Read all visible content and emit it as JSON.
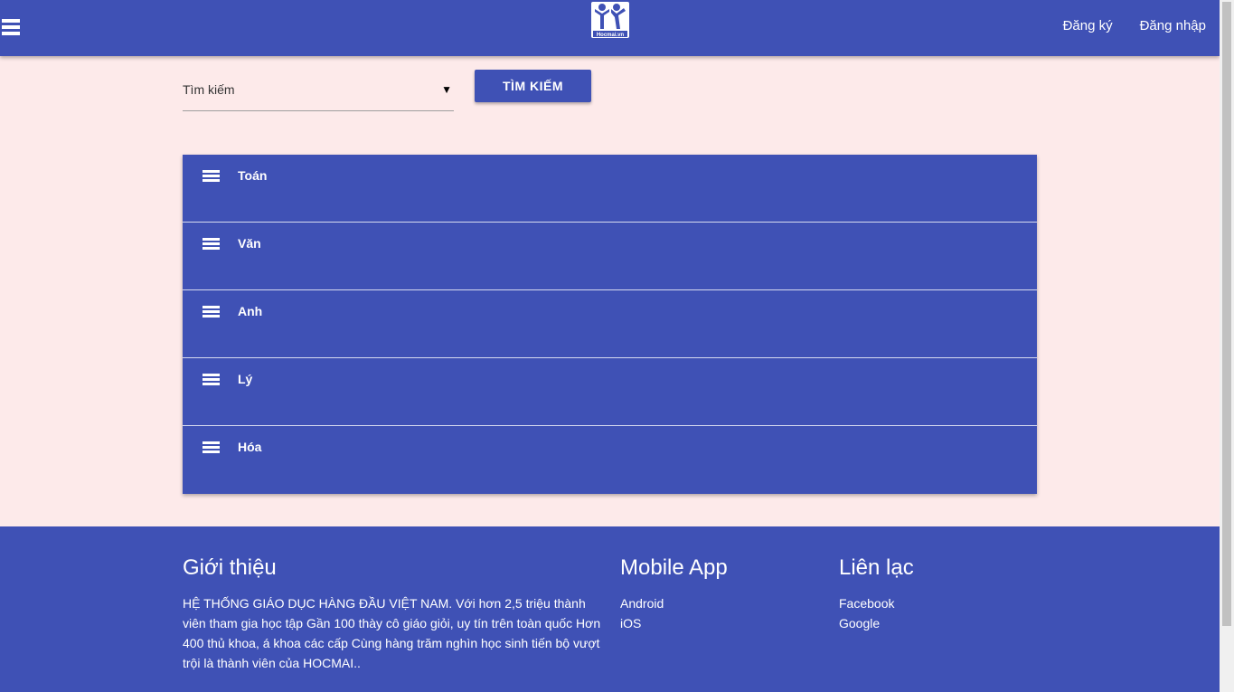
{
  "header": {
    "register_label": "Đăng ký",
    "login_label": "Đăng nhập",
    "logo_text": "Hocmai.vn"
  },
  "search": {
    "select_value": "Tìm kiếm",
    "button_label": "TÌM KIẾM"
  },
  "subjects": [
    {
      "label": "Toán"
    },
    {
      "label": "Văn"
    },
    {
      "label": "Anh"
    },
    {
      "label": "Lý"
    },
    {
      "label": "Hóa"
    }
  ],
  "footer": {
    "intro_title": "Giới thiệu",
    "intro_text": "HỆ THỐNG GIÁO DỤC HÀNG ĐẦU VIỆT NAM. Với hơn 2,5 triệu thành viên tham gia học tập Gần 100 thày cô giáo giỏi, uy tín trên toàn quốc Hơn 400 thủ khoa, á khoa các cấp Cùng hàng trăm nghìn học sinh tiến bộ vượt trội là thành viên của HOCMAI..",
    "mobile_title": "Mobile App",
    "mobile_links": [
      "Android",
      "iOS"
    ],
    "contact_title": "Liên lạc",
    "contact_links": [
      "Facebook",
      "Google"
    ]
  },
  "colors": {
    "primary": "#3f51b5",
    "background": "#fdeaea"
  }
}
